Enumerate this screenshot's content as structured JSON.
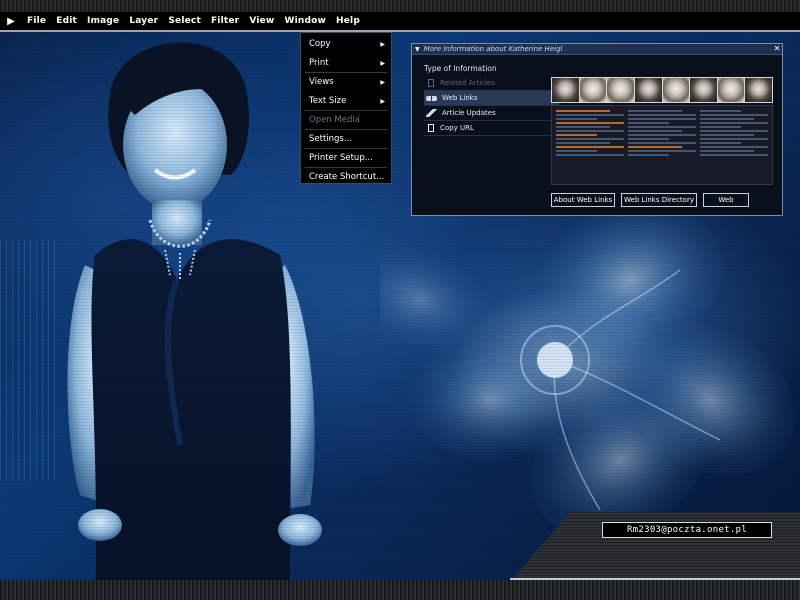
{
  "menubar": {
    "play_icon": "play-icon",
    "items": [
      "File",
      "Edit",
      "Image",
      "Layer",
      "Select",
      "Filter",
      "View",
      "Window",
      "Help"
    ]
  },
  "dropdown": {
    "items": [
      {
        "label": "Copy",
        "submenu": true,
        "disabled": false
      },
      {
        "label": "Print",
        "submenu": true,
        "disabled": false
      },
      {
        "label": "Views",
        "submenu": true,
        "disabled": false
      },
      {
        "label": "Text Size",
        "submenu": true,
        "disabled": false
      },
      {
        "label": "Open Media",
        "submenu": false,
        "disabled": true
      },
      {
        "label": "Settings...",
        "submenu": false,
        "disabled": false
      },
      {
        "label": "Printer Setup...",
        "submenu": false,
        "disabled": false
      },
      {
        "label": "Create Shortcut...",
        "submenu": false,
        "disabled": false
      }
    ]
  },
  "info_window": {
    "title": "More Information about Katherine Heigl",
    "heading": "Type of Information",
    "list": [
      {
        "label": "Related Articles",
        "icon": "document-icon",
        "state": "disabled"
      },
      {
        "label": "Web Links",
        "icon": "link-icon",
        "state": "selected"
      },
      {
        "label": "Article Updates",
        "icon": "lightning-icon",
        "state": "normal"
      },
      {
        "label": "Copy URL",
        "icon": "document-icon",
        "state": "normal"
      }
    ],
    "buttons": {
      "about": "About Web Links",
      "directory": "Web Links Directory",
      "web": "Web"
    }
  },
  "footer": {
    "email": "Rm2303@poczta.onet.pl"
  },
  "colors": {
    "accent_blue": "#1e2f52",
    "background_blue": "#0b3a78",
    "menu_bg": "#000000"
  }
}
